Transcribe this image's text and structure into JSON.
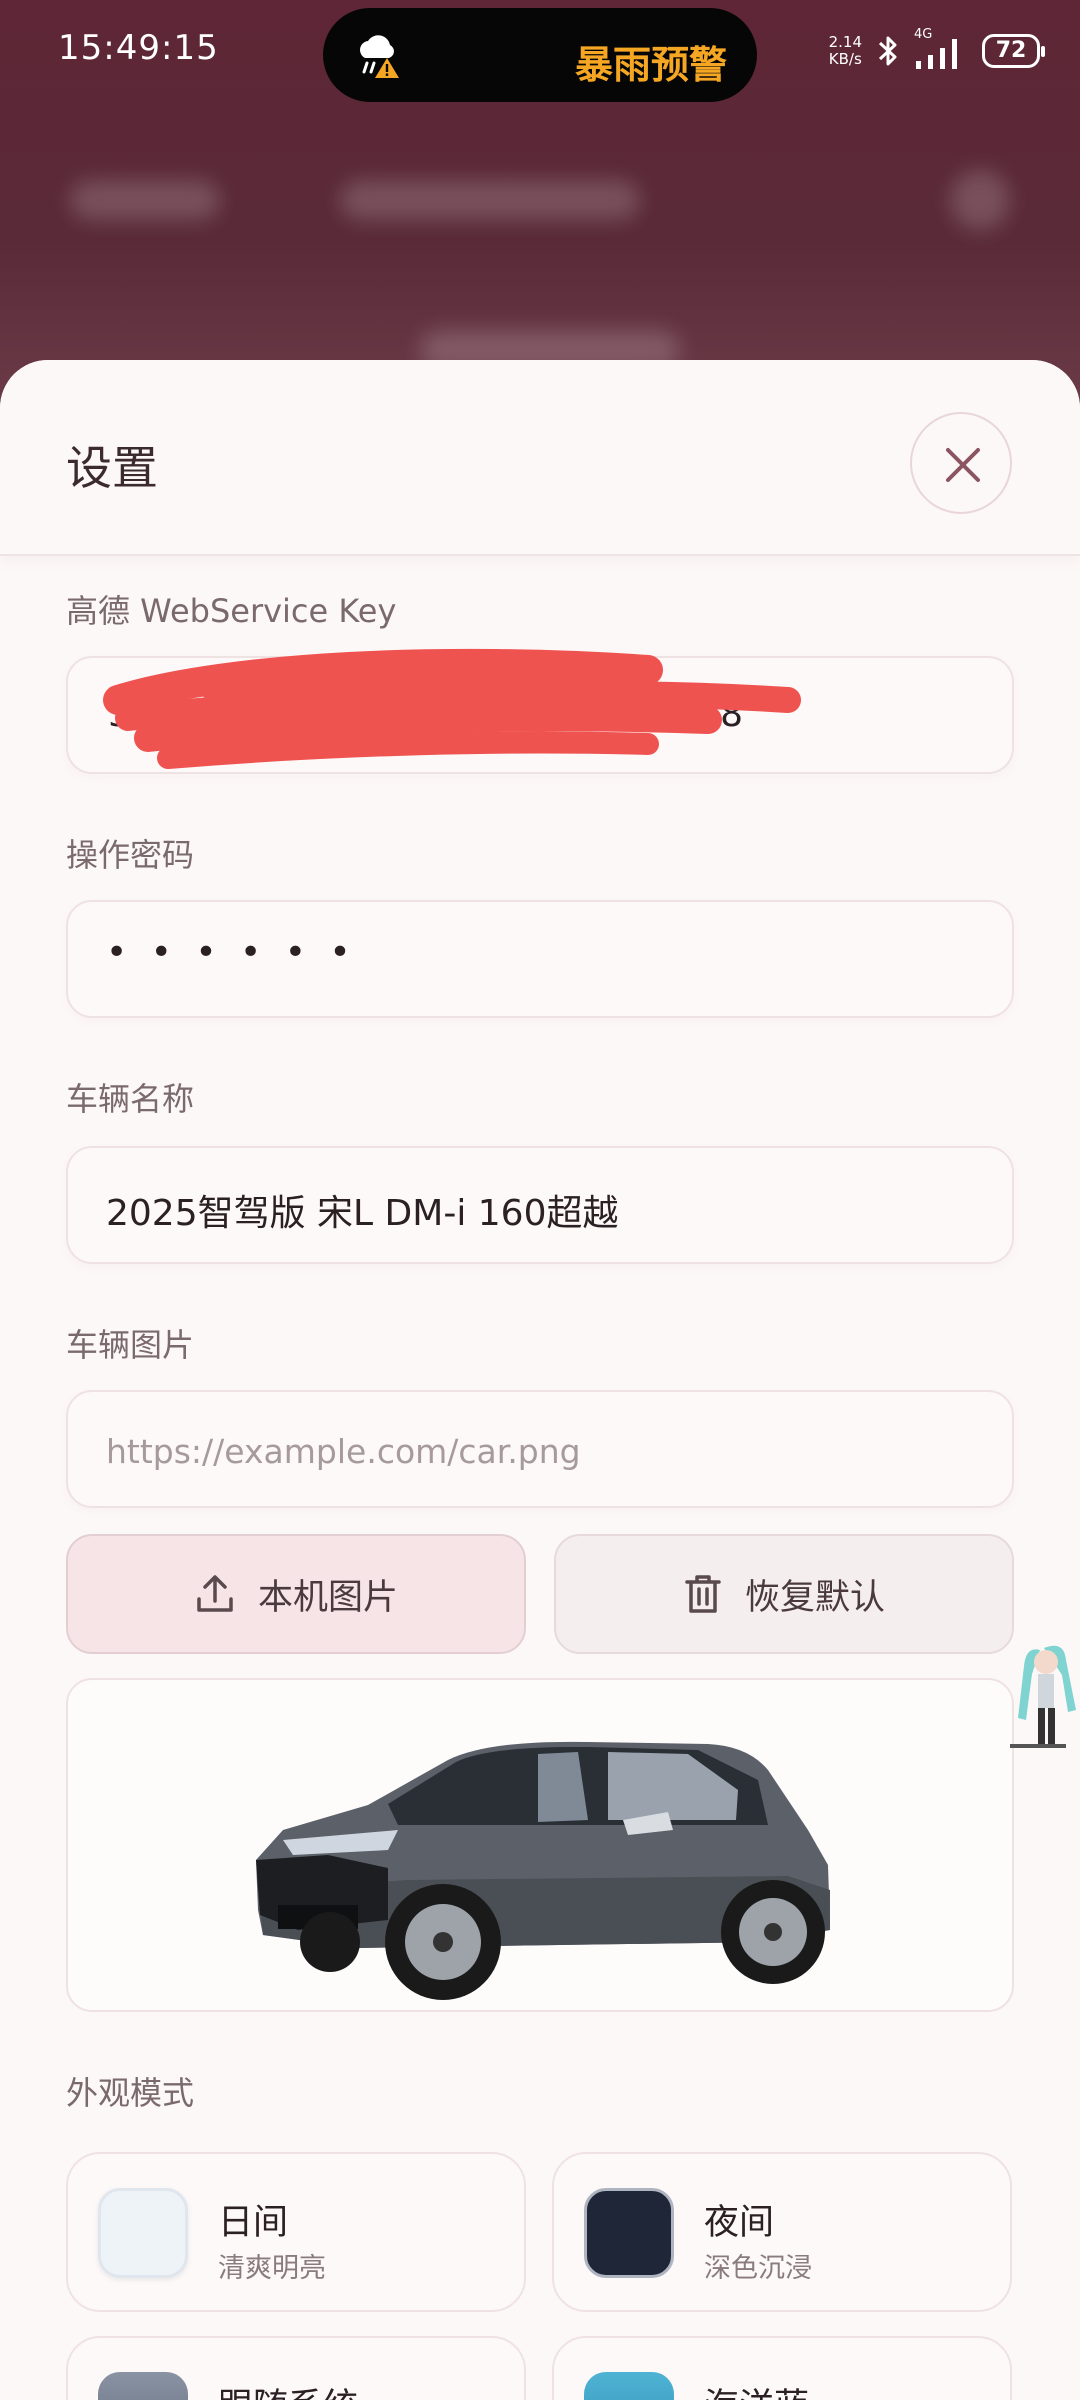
{
  "status_bar": {
    "time": "15:49:15",
    "alert_text": "暴雨预警",
    "net_speed_value": "2.14",
    "net_speed_unit": "KB/s",
    "network": "4G",
    "battery": "72"
  },
  "sheet": {
    "title": "设置"
  },
  "fields": {
    "amap_key": {
      "label": "高德 WebService Key",
      "value_visible_start": "3",
      "value_visible_end": "ia8"
    },
    "password": {
      "label": "操作密码",
      "value": "• • • • • •"
    },
    "vehicle_name": {
      "label": "车辆名称",
      "value": "2025智驾版 宋L DM-i 160超越"
    },
    "vehicle_image": {
      "label": "车辆图片",
      "placeholder": "https://example.com/car.png"
    }
  },
  "buttons": {
    "upload": "本机图片",
    "reset": "恢复默认"
  },
  "appearance": {
    "label": "外观模式",
    "modes": [
      {
        "name": "日间",
        "desc": "清爽明亮",
        "color": "#eef3f8"
      },
      {
        "name": "夜间",
        "desc": "深色沉浸",
        "color": "#1e2638"
      },
      {
        "name": "跟随系统",
        "desc": "",
        "color": "#7b8597"
      },
      {
        "name": "海洋蓝",
        "desc": "",
        "color": "#4fb3d4"
      }
    ]
  },
  "colors": {
    "accent_pink": "#f6e4e7",
    "alert_orange": "#f5a623",
    "redaction_red": "#ef5350"
  }
}
